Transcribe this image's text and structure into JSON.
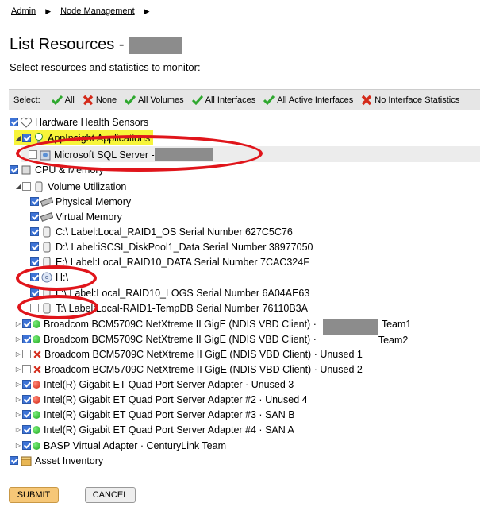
{
  "breadcrumb": {
    "items": [
      "Admin",
      "Node Management"
    ],
    "sep": "▶"
  },
  "page": {
    "title": "List Resources - ",
    "subtitle": "Select resources and statistics to monitor:"
  },
  "select_bar": {
    "label": "Select:",
    "options": [
      {
        "label": "All",
        "icon": "check-icon"
      },
      {
        "label": "None",
        "icon": "x-icon"
      },
      {
        "label": "All Volumes",
        "icon": "check-icon"
      },
      {
        "label": "All Interfaces",
        "icon": "check-icon"
      },
      {
        "label": "All Active Interfaces",
        "icon": "check-icon"
      },
      {
        "label": "No Interface Statistics",
        "icon": "x-icon"
      }
    ]
  },
  "tree": {
    "hardware": "Hardware Health Sensors",
    "appinsight": "AppInsight Applications",
    "mssql": "Microsoft SQL Server - ",
    "cpu": "CPU & Memory",
    "volume_util": "Volume Utilization",
    "physical_mem": "Physical Memory",
    "virtual_mem": "Virtual Memory",
    "vol_c": "C:\\ Label:Local_RAID1_OS Serial Number 627C5C76",
    "vol_d": "D:\\ Label:iSCSI_DiskPool1_Data Serial Number 38977050",
    "vol_e": "E:\\ Label:Local_RAID10_DATA Serial Number 7CAC324F",
    "vol_h": "H:\\",
    "vol_l": "L:\\ Label:Local_RAID10_LOGS Serial Number 6A04AE63",
    "vol_t": "T:\\ Label:Local-RAID1-TempDB Serial Number 76110B3A",
    "nic1": "Broadcom BCM5709C NetXtreme II GigE (NDIS VBD Client) ·",
    "nic1_suffix": "Team1",
    "nic2": "Broadcom BCM5709C NetXtreme II GigE (NDIS VBD Client) ·",
    "nic2_suffix": "Team2",
    "nic3": "Broadcom BCM5709C NetXtreme II GigE (NDIS VBD Client) · Unused 1",
    "nic4": "Broadcom BCM5709C NetXtreme II GigE (NDIS VBD Client) · Unused 2",
    "intel1": "Intel(R) Gigabit ET Quad Port Server Adapter · Unused 3",
    "intel2": "Intel(R) Gigabit ET Quad Port Server Adapter #2 · Unused 4",
    "intel3": "Intel(R) Gigabit ET Quad Port Server Adapter #3 · SAN B",
    "intel4": "Intel(R) Gigabit ET Quad Port Server Adapter #4 · SAN A",
    "basp": "BASP Virtual Adapter · CenturyLink Team",
    "asset": "Asset Inventory"
  },
  "buttons": {
    "submit": "SUBMIT",
    "cancel": "CANCEL"
  },
  "colors": {
    "highlight": "#f7f43a",
    "annotation": "#e0151b",
    "submit_bg": "#f6c777",
    "checkbox_on": "#3d73d6"
  }
}
